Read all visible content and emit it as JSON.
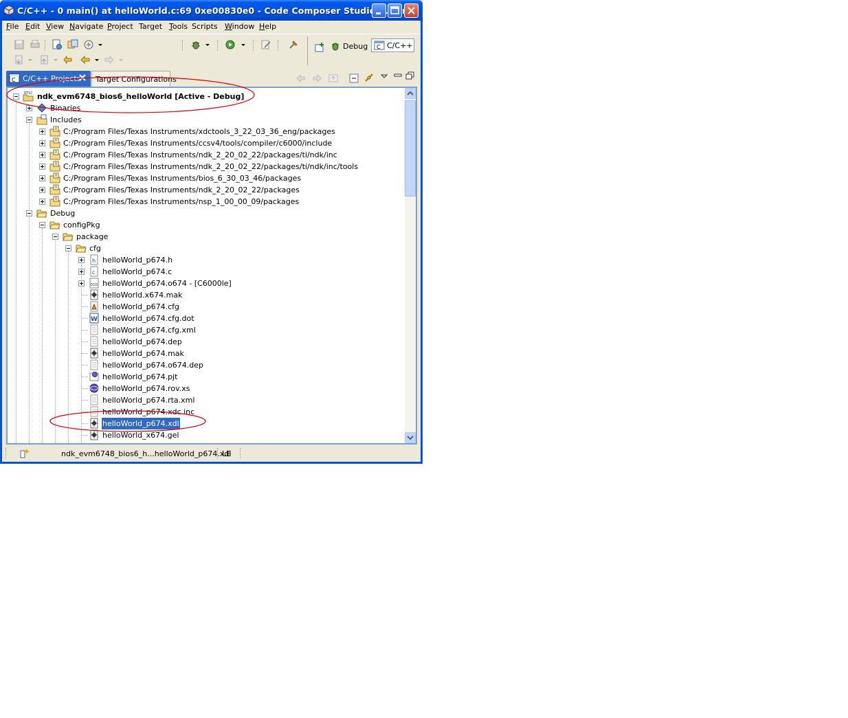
{
  "window": {
    "title": "C/C++ - 0 main() at helloWorld.c:69 0xe00830e0 - Code Composer Studio (Licen...",
    "buttons": [
      "minimize",
      "maximize",
      "close"
    ]
  },
  "menubar": {
    "items": [
      {
        "pre": "",
        "u": "F",
        "post": "ile"
      },
      {
        "pre": "",
        "u": "E",
        "post": "dit"
      },
      {
        "pre": "",
        "u": "V",
        "post": "iew"
      },
      {
        "pre": "",
        "u": "N",
        "post": "avigate"
      },
      {
        "pre": "",
        "u": "P",
        "post": "roject"
      },
      {
        "pre": "Tar",
        "u": "g",
        "post": "et"
      },
      {
        "pre": "",
        "u": "T",
        "post": "ools"
      },
      {
        "pre": "Scripts",
        "u": "",
        "post": ""
      },
      {
        "pre": "",
        "u": "W",
        "post": "indow"
      },
      {
        "pre": "",
        "u": "H",
        "post": "elp"
      }
    ]
  },
  "perspectives": {
    "debug_label": "Debug",
    "cpp_label": "C/C++"
  },
  "view": {
    "tabs": {
      "active": "C/C++ Projects",
      "inactive": "Target Configurations"
    },
    "tree": {
      "project": "ndk_evm6748_bios6_helloWorld  [Active - Debug]",
      "binaries": "Binaries",
      "includes": "Includes",
      "include_paths": [
        "C:/Program Files/Texas Instruments/xdctools_3_22_03_36_eng/packages",
        "C:/Program Files/Texas Instruments/ccsv4/tools/compiler/c6000/include",
        "C:/Program Files/Texas Instruments/ndk_2_20_02_22/packages/ti/ndk/inc",
        "C:/Program Files/Texas Instruments/ndk_2_20_02_22/packages/ti/ndk/inc/tools",
        "C:/Program Files/Texas Instruments/bios_6_30_03_46/packages",
        "C:/Program Files/Texas Instruments/ndk_2_20_02_22/packages",
        "C:/Program Files/Texas Instruments/nsp_1_00_00_09/packages"
      ],
      "debug": "Debug",
      "configpkg": "configPkg",
      "package": "package",
      "cfg": "cfg",
      "cfg_files": [
        {
          "name": "helloWorld_p674.h",
          "icon": "h-file-icon",
          "expandable": true
        },
        {
          "name": "helloWorld_p674.c",
          "icon": "c-file-icon",
          "expandable": true
        },
        {
          "name": "helloWorld_p674.o674 - [C6000le]",
          "icon": "object-file-icon",
          "expandable": true
        },
        {
          "name": "helloWorld.x674.mak",
          "icon": "makefile-icon",
          "expandable": false
        },
        {
          "name": "helloWorld_p674.cfg",
          "icon": "cfg-file-icon",
          "expandable": false
        },
        {
          "name": "helloWorld_p674.cfg.dot",
          "icon": "word-file-icon",
          "expandable": false
        },
        {
          "name": "helloWorld_p674.cfg.xml",
          "icon": "text-file-icon",
          "expandable": false
        },
        {
          "name": "helloWorld_p674.dep",
          "icon": "text-file-icon",
          "expandable": false
        },
        {
          "name": "helloWorld_p674.mak",
          "icon": "makefile-icon",
          "expandable": false
        },
        {
          "name": "helloWorld_p674.o674.dep",
          "icon": "text-file-icon",
          "expandable": false
        },
        {
          "name": "helloWorld_p674.pjt",
          "icon": "pjt-file-icon",
          "expandable": false
        },
        {
          "name": "helloWorld_p674.rov.xs",
          "icon": "xs-file-icon",
          "expandable": false
        },
        {
          "name": "helloWorld_p674.rta.xml",
          "icon": "text-file-icon",
          "expandable": false
        },
        {
          "name": "helloWorld_p674.xdc.inc",
          "icon": "text-file-icon",
          "expandable": false
        },
        {
          "name": "helloWorld_p674.xdl",
          "icon": "makefile-icon",
          "expandable": false,
          "selected": true
        },
        {
          "name": "helloWorld_x674.gel",
          "icon": "makefile-icon",
          "expandable": false
        }
      ]
    }
  },
  "statusbar": {
    "path": "ndk_evm6748_bios6_h...helloWorld_p674.xdl",
    "mode": "LE"
  },
  "colors": {
    "title_blue": "#0054e3",
    "chrome": "#ece9d8",
    "selection": "#316ac5",
    "annotation_red": "#e00000"
  }
}
